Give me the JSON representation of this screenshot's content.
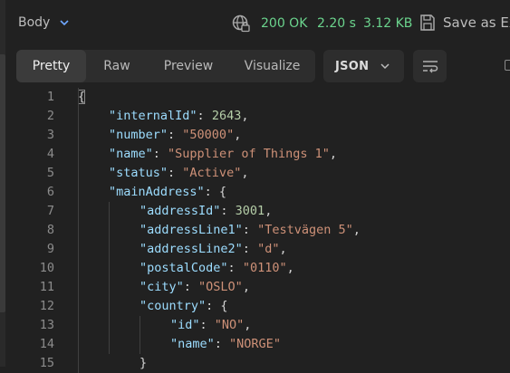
{
  "header": {
    "body_label": "Body",
    "status_code": "200 OK",
    "time": "2.20 s",
    "size": "3.12 KB",
    "save_label": "Save as Ex",
    "status_color": "#6bd48d"
  },
  "tabs": [
    {
      "label": "Pretty",
      "active": true
    },
    {
      "label": "Raw",
      "active": false
    },
    {
      "label": "Preview",
      "active": false
    },
    {
      "label": "Visualize",
      "active": false
    }
  ],
  "format": {
    "selected": "JSON"
  },
  "icons": {
    "globe": "globe-lock-icon",
    "save": "save-icon",
    "wrap": "wrap-lines-icon",
    "chevron": "chevron-down-icon"
  },
  "code": {
    "lines": [
      {
        "n": "1",
        "indent": 0,
        "tokens": [
          {
            "t": "{",
            "c": "p"
          }
        ]
      },
      {
        "n": "2",
        "indent": 1,
        "tokens": [
          {
            "t": "\"internalId\"",
            "c": "k"
          },
          {
            "t": ": ",
            "c": "p"
          },
          {
            "t": "2643",
            "c": "n"
          },
          {
            "t": ",",
            "c": "p"
          }
        ]
      },
      {
        "n": "3",
        "indent": 1,
        "tokens": [
          {
            "t": "\"number\"",
            "c": "k"
          },
          {
            "t": ": ",
            "c": "p"
          },
          {
            "t": "\"50000\"",
            "c": "s"
          },
          {
            "t": ",",
            "c": "p"
          }
        ]
      },
      {
        "n": "4",
        "indent": 1,
        "tokens": [
          {
            "t": "\"name\"",
            "c": "k"
          },
          {
            "t": ": ",
            "c": "p"
          },
          {
            "t": "\"Supplier of Things 1\"",
            "c": "s"
          },
          {
            "t": ",",
            "c": "p"
          }
        ]
      },
      {
        "n": "5",
        "indent": 1,
        "tokens": [
          {
            "t": "\"status\"",
            "c": "k"
          },
          {
            "t": ": ",
            "c": "p"
          },
          {
            "t": "\"Active\"",
            "c": "s"
          },
          {
            "t": ",",
            "c": "p"
          }
        ]
      },
      {
        "n": "6",
        "indent": 1,
        "tokens": [
          {
            "t": "\"mainAddress\"",
            "c": "k"
          },
          {
            "t": ": {",
            "c": "p"
          }
        ]
      },
      {
        "n": "7",
        "indent": 2,
        "tokens": [
          {
            "t": "\"addressId\"",
            "c": "k"
          },
          {
            "t": ": ",
            "c": "p"
          },
          {
            "t": "3001",
            "c": "n"
          },
          {
            "t": ",",
            "c": "p"
          }
        ]
      },
      {
        "n": "8",
        "indent": 2,
        "tokens": [
          {
            "t": "\"addressLine1\"",
            "c": "k"
          },
          {
            "t": ": ",
            "c": "p"
          },
          {
            "t": "\"Testvägen 5\"",
            "c": "s"
          },
          {
            "t": ",",
            "c": "p"
          }
        ]
      },
      {
        "n": "9",
        "indent": 2,
        "tokens": [
          {
            "t": "\"addressLine2\"",
            "c": "k"
          },
          {
            "t": ": ",
            "c": "p"
          },
          {
            "t": "\"d\"",
            "c": "s"
          },
          {
            "t": ",",
            "c": "p"
          }
        ]
      },
      {
        "n": "10",
        "indent": 2,
        "tokens": [
          {
            "t": "\"postalCode\"",
            "c": "k"
          },
          {
            "t": ": ",
            "c": "p"
          },
          {
            "t": "\"0110\"",
            "c": "s"
          },
          {
            "t": ",",
            "c": "p"
          }
        ]
      },
      {
        "n": "11",
        "indent": 2,
        "tokens": [
          {
            "t": "\"city\"",
            "c": "k"
          },
          {
            "t": ": ",
            "c": "p"
          },
          {
            "t": "\"OSLO\"",
            "c": "s"
          },
          {
            "t": ",",
            "c": "p"
          }
        ]
      },
      {
        "n": "12",
        "indent": 2,
        "tokens": [
          {
            "t": "\"country\"",
            "c": "k"
          },
          {
            "t": ": {",
            "c": "p"
          }
        ]
      },
      {
        "n": "13",
        "indent": 3,
        "tokens": [
          {
            "t": "\"id\"",
            "c": "k"
          },
          {
            "t": ": ",
            "c": "p"
          },
          {
            "t": "\"NO\"",
            "c": "s"
          },
          {
            "t": ",",
            "c": "p"
          }
        ]
      },
      {
        "n": "14",
        "indent": 3,
        "tokens": [
          {
            "t": "\"name\"",
            "c": "k"
          },
          {
            "t": ": ",
            "c": "p"
          },
          {
            "t": "\"NORGE\"",
            "c": "s"
          }
        ]
      },
      {
        "n": "15",
        "indent": 2,
        "tokens": [
          {
            "t": "}",
            "c": "p"
          }
        ]
      }
    ]
  }
}
